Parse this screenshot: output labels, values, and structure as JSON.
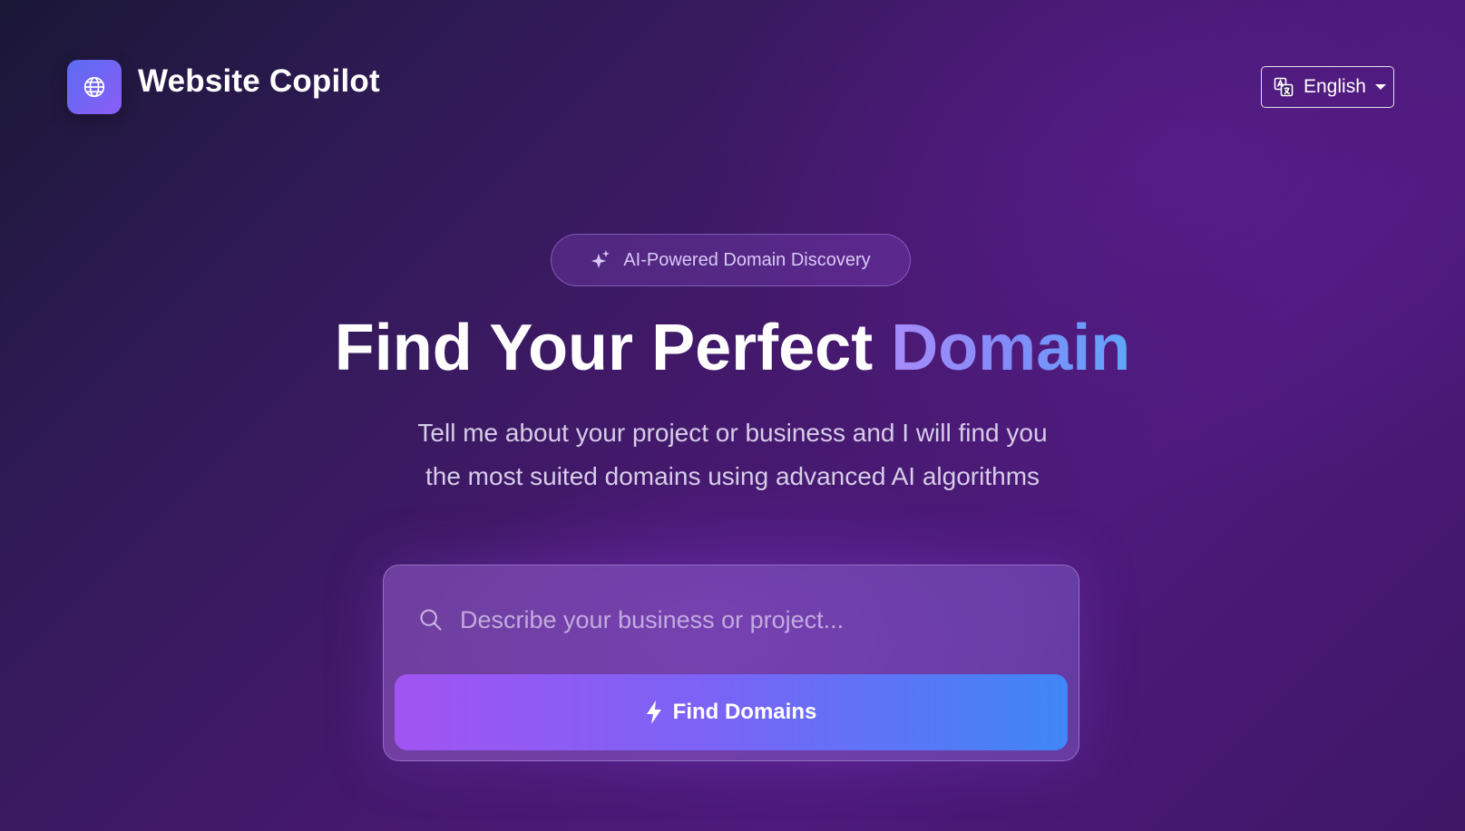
{
  "header": {
    "brand_name": "Website Copilot",
    "logo_icon": "globe-icon",
    "language": {
      "icon": "translate-icon",
      "selected": "English"
    }
  },
  "hero": {
    "badge": {
      "icon": "sparkles-icon",
      "label": "AI-Powered Domain Discovery"
    },
    "title_main": "Find Your Perfect",
    "title_accent": "Domain",
    "subtitle_line1": "Tell me about your project or business and I will find you",
    "subtitle_line2": "the most suited domains using advanced AI algorithms"
  },
  "search": {
    "icon": "search-icon",
    "placeholder": "Describe your business or project...",
    "value": "",
    "button_icon": "lightning-icon",
    "button_label": "Find Domains"
  },
  "colors": {
    "background_start": "#1a1736",
    "background_end": "#4e1a7c",
    "logo_gradient_start": "#5b6cf2",
    "logo_gradient_end": "#8b5cf6",
    "accent_gradient_start": "#a78bfa",
    "accent_gradient_end": "#60a5fa",
    "button_gradient_start": "#a154f2",
    "button_gradient_end": "#3f86f6"
  }
}
